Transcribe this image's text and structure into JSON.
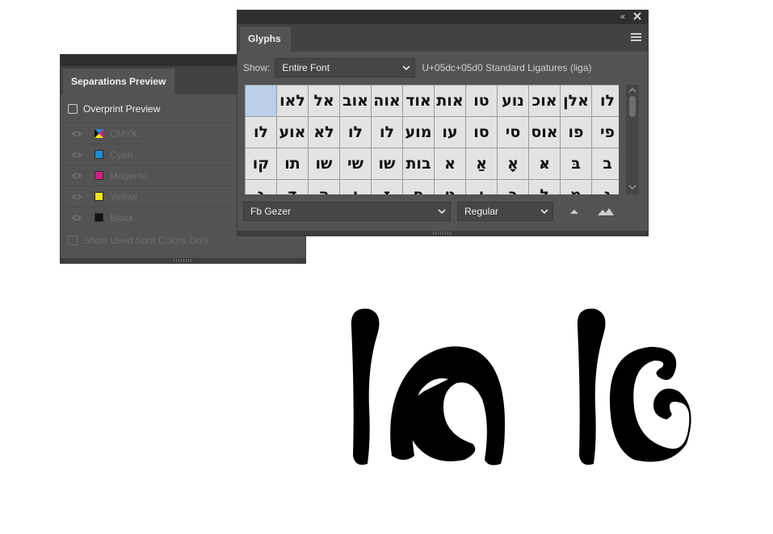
{
  "separations_panel": {
    "tab_title": "Separations Preview",
    "overprint_label": "Overprint Preview",
    "separations": [
      {
        "label": "CMYK",
        "color": "cmyk"
      },
      {
        "label": "Cyan",
        "color": "#1c8fd6"
      },
      {
        "label": "Magenta",
        "color": "#d41e8a"
      },
      {
        "label": "Yellow",
        "color": "#f5e61b"
      },
      {
        "label": "Black",
        "color": "#111111"
      }
    ],
    "spot_label": "Show Used Spot Colors Only"
  },
  "glyphs_panel": {
    "tab_title": "Glyphs",
    "show_label": "Show:",
    "show_value": "Entire Font",
    "glyph_info": "U+05dc+05d0 Standard Ligatures (liga)",
    "font_family": "Fb Gezer",
    "font_style": "Regular",
    "glyphs": [
      "",
      "לאו",
      "אל",
      "אוב",
      "אוה",
      "אוד",
      "אות",
      "טו",
      "נוע",
      "אוכ",
      "אלן",
      "לו",
      "לו",
      "אוע",
      "לא",
      "לו",
      "לו",
      "מוע",
      "עו",
      "סו",
      "סי",
      "אוס",
      "פו",
      "פי",
      "קו",
      "תו",
      "שו",
      "שי",
      "שו",
      "בות",
      "א",
      "אַ",
      "אָ",
      "אּ",
      "בּ",
      "ב",
      "ג",
      "ד",
      "ה",
      "ו",
      "ז",
      "ח",
      "ט",
      "י",
      "כ",
      "ל",
      "מ",
      "נ"
    ]
  },
  "canvas": {
    "glyph_preview": "לאו"
  }
}
